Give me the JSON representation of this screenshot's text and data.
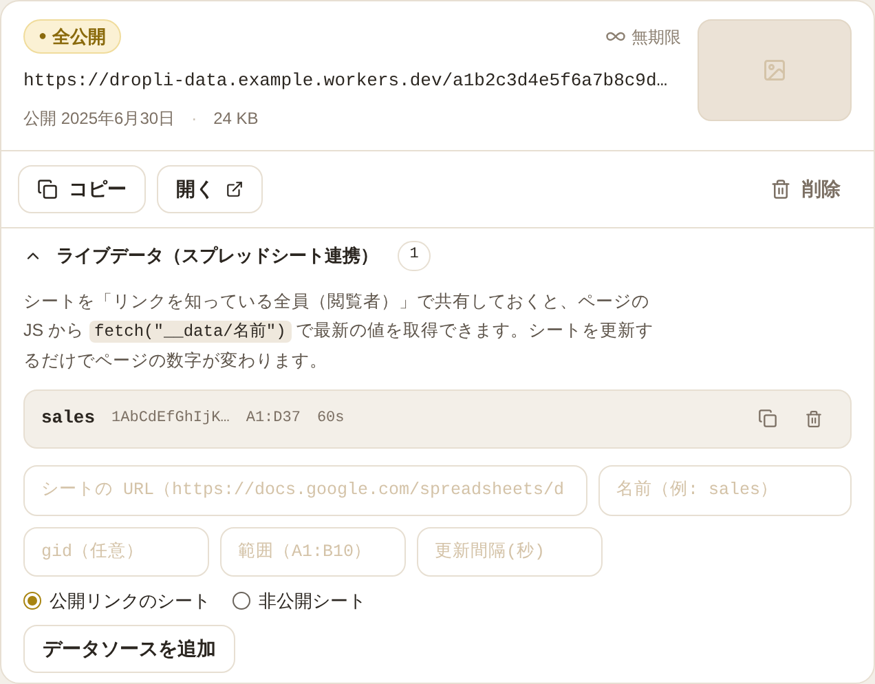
{
  "header": {
    "badge": {
      "label": "全公開",
      "dot": "●"
    },
    "expiry": "無期限",
    "url": "https://dropli-data.example.workers.dev/a1b2c3d4e5f6a7b8c9d…",
    "published": "公開 2025年6月30日",
    "separator": "·",
    "size": "24 KB"
  },
  "actions": [
    {
      "kind": "copy",
      "label": "コピー"
    },
    {
      "kind": "open",
      "label": "開く"
    },
    {
      "kind": "delete",
      "label": "削除"
    }
  ],
  "live_data": {
    "title": "ライブデータ（スプレッドシート連携）",
    "count": "1",
    "expanded": true,
    "description": {
      "before": "シートを「リンクを知っている全員（閲覧者）」で共有しておくと、ページの JS から ",
      "code": "fetch(\"__data/名前\")",
      "after": " で最新の値を取得できます。シートを更新するだけでページの数字が変わります。"
    },
    "sources": [
      {
        "name": "sales",
        "sheet_id": "1AbCdEfGhIjK…",
        "range": "A1:D37",
        "interval": "60s"
      }
    ],
    "fields": [
      {
        "placeholder": "シートの URL（https://docs.google.com/spreadsheets/d"
      },
      {
        "placeholder": "名前（例: sales）"
      },
      {
        "placeholder": "gid（任意）"
      },
      {
        "placeholder": "範囲（A1:B10）"
      },
      {
        "placeholder": "更新間隔(秒)"
      }
    ],
    "radios": [
      {
        "label": "公開リンクのシート",
        "selected": true
      },
      {
        "label": "非公開シート",
        "selected": false
      }
    ],
    "add_button": "データソースを追加"
  }
}
